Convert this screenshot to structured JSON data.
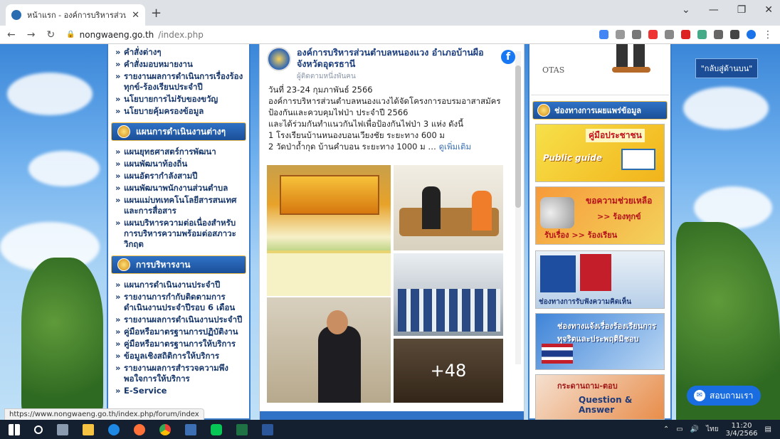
{
  "browser": {
    "tab_title": "หน้าแรก - องค์การบริหารส่วนตำบลหนองแวง อำเภอบ้านผือ",
    "url_host": "nongwaeng.go.th",
    "url_path": "/index.php",
    "status_url": "https://www.nongwaeng.go.th/index.php/forum/index"
  },
  "left_nav": {
    "group1": [
      "คำสั่งต่างๆ",
      "คำสั่งมอบหมายงาน",
      "รายงานผลการดำเนินการเรื่องร้องทุกข์-ร้องเรียนประจำปี",
      "นโยบายการไม่รับของขวัญ",
      "นโยบายคุ้มครองข้อมูล"
    ],
    "section2_title": "แผนการดำเนินงานต่างๆ",
    "group2": [
      "แผนยุทธศาสตร์การพัฒนา",
      "แผนพัฒนาท้องถิ่น",
      "แผนอัตรากำลังสามปี",
      "แผนพัฒนาพนักงานส่วนตำบล",
      "แผนแม่บทเทคโนโลยีสารสนเทศและการสื่อสาร",
      "แผนบริหารความต่อเนื่องสำหรับการบริหารความพร้อมต่อสภาวะวิกฤต"
    ],
    "section3_title": "การบริหารงาน",
    "group3": [
      "แผนการดำเนินงานประจำปี",
      "รายงานการกำกับติดตามการดำเนินงานประจำปีรอบ 6 เดือน",
      "รายงานผลการดำเนินงานประจำปี",
      "คู่มือหรือมาตรฐานการปฏิบัติงาน",
      "คู่มือหรือมาตรฐานการให้บริการ",
      "ข้อมูลเชิงสถิติการให้บริการ",
      "รายงานผลการสำรวจความพึงพอใจการให้บริการ",
      "E-Service"
    ]
  },
  "facebook_post": {
    "page_name": "องค์การบริหารส่วนตำบลหนองแวง อำเภอบ้านผือ จังหวัดอุดรธานี",
    "followers": "ผู้ติดตามหนึ่งพันคน",
    "line1": "วันที่ 23-24 กุมภาพันธ์ 2566",
    "line2": "องค์การบริหารส่วนตำบลหนองแวงได้จัดโครงการอบรมอาสาสมัครป้องกันและควบคุมไฟป่า ประจำปี 2566",
    "line3": "และได้ร่วมกันทำแนวกันไฟเพื่อป้องกันไฟป่า 3 แห่ง ดังนี้",
    "line4": "1 โรงเรียนบ้านหนองบอนเวียงชัย ระยะทาง 600 ม",
    "line5": "2 วัดป่าถ้ำกุด บ้านคำบอน ระยะทาง 1000 ม",
    "see_more": "ดูเพิ่มเติม",
    "more_photos": "+48"
  },
  "right_panel": {
    "otas_label": "OTAS",
    "section_title": "ช่องทางการเผยแพร่ข้อมูล",
    "banner1_title": "คู่มือประชาชน",
    "banner1_sub": "Public guide",
    "banner2_line1": "ขอความช่วยเหลือ",
    "banner2_line2": ">> ร้องทุกข์",
    "banner2_line3": "รับเรื่อง >> ร้องเรียน",
    "banner3_text": "ช่องทางการรับฟังความคิดเห็น",
    "banner4_text": "ช่องทางแจ้งเรื่องร้องเรียนการทุจริตและประพฤติมิชอบ",
    "banner5_line1": "กระดานถาม-ตอบ",
    "banner5_line2": "Question & Answer"
  },
  "floating": {
    "back_to_top": "\"กลับสู่ด้านบน\"",
    "chat_label": "สอบถามเรา"
  },
  "taskbar": {
    "lang": "ไทย",
    "time": "11:20",
    "date": "3/4/2566"
  }
}
